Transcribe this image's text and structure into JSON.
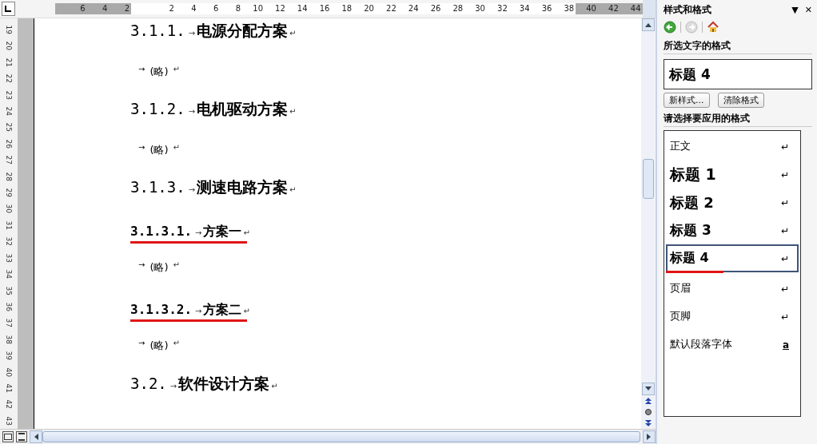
{
  "ruler": {
    "ticks": [
      {
        "label": "6",
        "margin": true
      },
      {
        "label": "4",
        "margin": true
      },
      {
        "label": "2",
        "margin": true
      },
      {
        "label": "2",
        "margin": false
      },
      {
        "label": "4",
        "margin": false
      },
      {
        "label": "6",
        "margin": false
      },
      {
        "label": "8",
        "margin": false
      },
      {
        "label": "10",
        "margin": false
      },
      {
        "label": "12",
        "margin": false
      },
      {
        "label": "14",
        "margin": false
      },
      {
        "label": "16",
        "margin": false
      },
      {
        "label": "18",
        "margin": false
      },
      {
        "label": "20",
        "margin": false
      },
      {
        "label": "22",
        "margin": false
      },
      {
        "label": "24",
        "margin": false
      },
      {
        "label": "26",
        "margin": false
      },
      {
        "label": "28",
        "margin": false
      },
      {
        "label": "30",
        "margin": false
      },
      {
        "label": "32",
        "margin": false
      },
      {
        "label": "34",
        "margin": false
      },
      {
        "label": "36",
        "margin": false
      },
      {
        "label": "38",
        "margin": false
      },
      {
        "label": "40",
        "margin": true
      },
      {
        "label": "42",
        "margin": true
      },
      {
        "label": "44",
        "margin": true
      }
    ]
  },
  "vertical_ruler": [
    "19",
    "20",
    "21",
    "22",
    "23",
    "24",
    "25",
    "26",
    "27",
    "28",
    "29",
    "30",
    "31",
    "32",
    "33",
    "34",
    "35",
    "36",
    "37",
    "38",
    "39",
    "40",
    "41",
    "42",
    "43"
  ],
  "document": [
    {
      "kind": "heading3",
      "number": "3.1.1.",
      "tab": "→",
      "title": "电源分配方案",
      "mark": "↵",
      "underlined": false
    },
    {
      "kind": "body",
      "tab": "→",
      "text": "(略)",
      "mark": "↵"
    },
    {
      "kind": "heading3",
      "number": "3.1.2.",
      "tab": "→",
      "title": "电机驱动方案",
      "mark": "↵",
      "underlined": false
    },
    {
      "kind": "body",
      "tab": "→",
      "text": "(略)",
      "mark": "↵"
    },
    {
      "kind": "heading3",
      "number": "3.1.3.",
      "tab": "→",
      "title": "测速电路方案",
      "mark": "↵",
      "underlined": false
    },
    {
      "kind": "heading4",
      "number": "3.1.3.1.",
      "tab": "→",
      "title": "方案一",
      "mark": "↵",
      "underlined": true
    },
    {
      "kind": "body",
      "tab": "→",
      "text": "(略)",
      "mark": "↵"
    },
    {
      "kind": "heading4",
      "number": "3.1.3.2.",
      "tab": "→",
      "title": "方案二",
      "mark": "↵",
      "underlined": true
    },
    {
      "kind": "body",
      "tab": "→",
      "text": "(略)",
      "mark": "↵"
    },
    {
      "kind": "heading2",
      "number": "3.2.",
      "tab": "→",
      "title": "软件设计方案",
      "mark": "↵",
      "underlined": false
    }
  ],
  "task_pane": {
    "title": "样式和格式",
    "menu_glyph": "▼",
    "close_glyph": "✕",
    "selected_heading": "所选文字的格式",
    "current_style": "标题 4",
    "buttons": [
      "新样式...",
      "清除格式"
    ],
    "apply_heading": "请选择要应用的格式",
    "styles": [
      {
        "kind": "normal",
        "name": "正文",
        "glyph": "↵",
        "selected": false,
        "underlined": false
      },
      {
        "kind": "h1",
        "name": "标题 1",
        "glyph": "↵",
        "selected": false,
        "underlined": false
      },
      {
        "kind": "h2",
        "name": "标题 2",
        "glyph": "↵",
        "selected": false,
        "underlined": false
      },
      {
        "kind": "h3",
        "name": "标题 3",
        "glyph": "↵",
        "selected": false,
        "underlined": false
      },
      {
        "kind": "h4",
        "name": "标题 4",
        "glyph": "↵",
        "selected": true,
        "underlined": true
      },
      {
        "kind": "normal",
        "name": "页眉",
        "glyph": "↵",
        "selected": false,
        "underlined": false
      },
      {
        "kind": "normal",
        "name": "页脚",
        "glyph": "↵",
        "selected": false,
        "underlined": false
      },
      {
        "kind": "char",
        "name": "默认段落字体",
        "glyph": "a",
        "selected": false,
        "underlined": false
      }
    ]
  }
}
